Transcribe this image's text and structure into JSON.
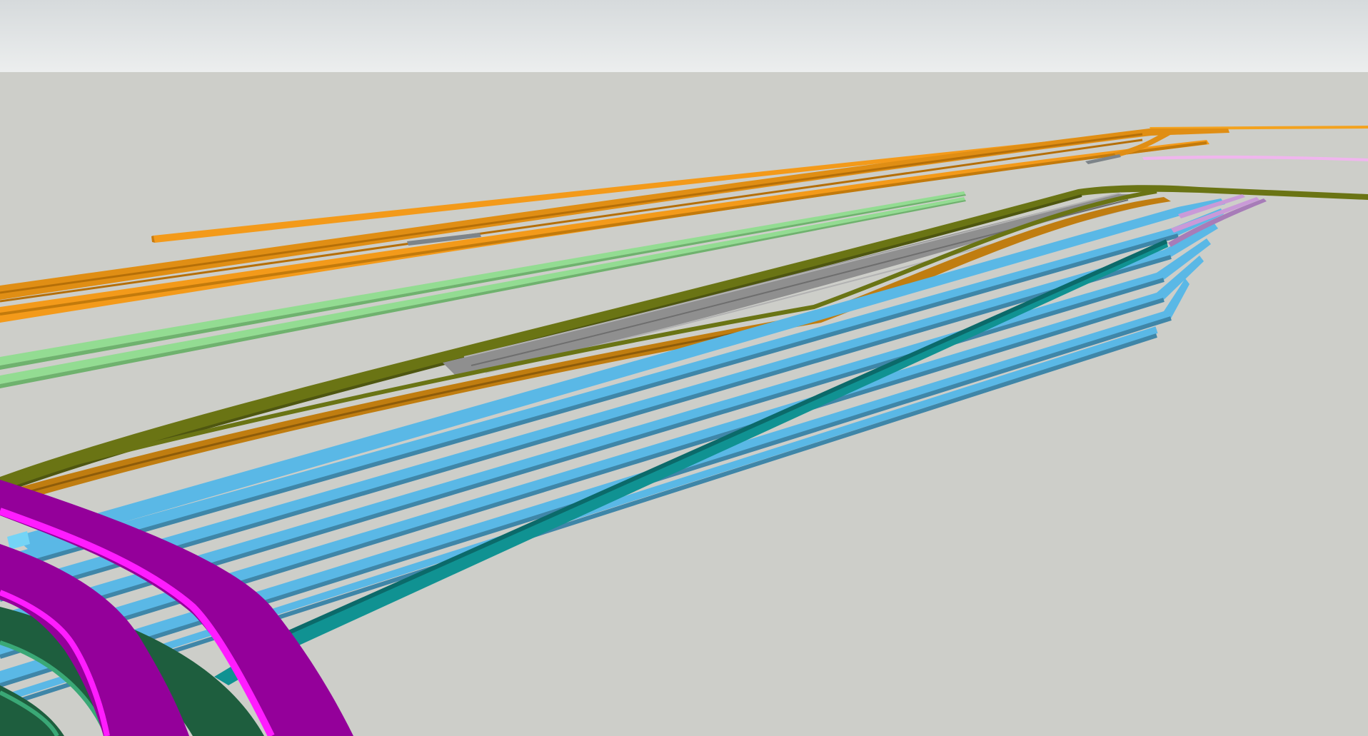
{
  "viewport": {
    "sky_color": "#e2e5e6",
    "ground_color": "#cdcec9"
  },
  "track_groups": [
    {
      "name": "orange-tracks",
      "color": "#f39a1a",
      "dark": "#c97a0c"
    },
    {
      "name": "light-green-tracks",
      "color": "#93dc92",
      "dark": "#6fb26e"
    },
    {
      "name": "olive-tracks",
      "color": "#6a7414",
      "dark": "#4e5610"
    },
    {
      "name": "gray-tracks",
      "color": "#8f8f8f",
      "dark": "#6e6e6e"
    },
    {
      "name": "amber-tracks",
      "color": "#c07d10",
      "dark": "#8e5c0a"
    },
    {
      "name": "blue-tracks",
      "color": "#5ab8e6",
      "dark": "#3f86a8"
    },
    {
      "name": "teal-track",
      "color": "#109292",
      "dark": "#0b6a6a"
    },
    {
      "name": "magenta-ramps",
      "color": "#94009a",
      "dark": "#ff1cff"
    },
    {
      "name": "dark-green-ramps",
      "color": "#1e5e3e",
      "dark": "#3aa876"
    },
    {
      "name": "pink-track",
      "color": "#f0b6ee",
      "dark": "#d49ad2"
    },
    {
      "name": "lilac-tracks",
      "color": "#c99ad8",
      "dark": "#a77cb8"
    }
  ]
}
